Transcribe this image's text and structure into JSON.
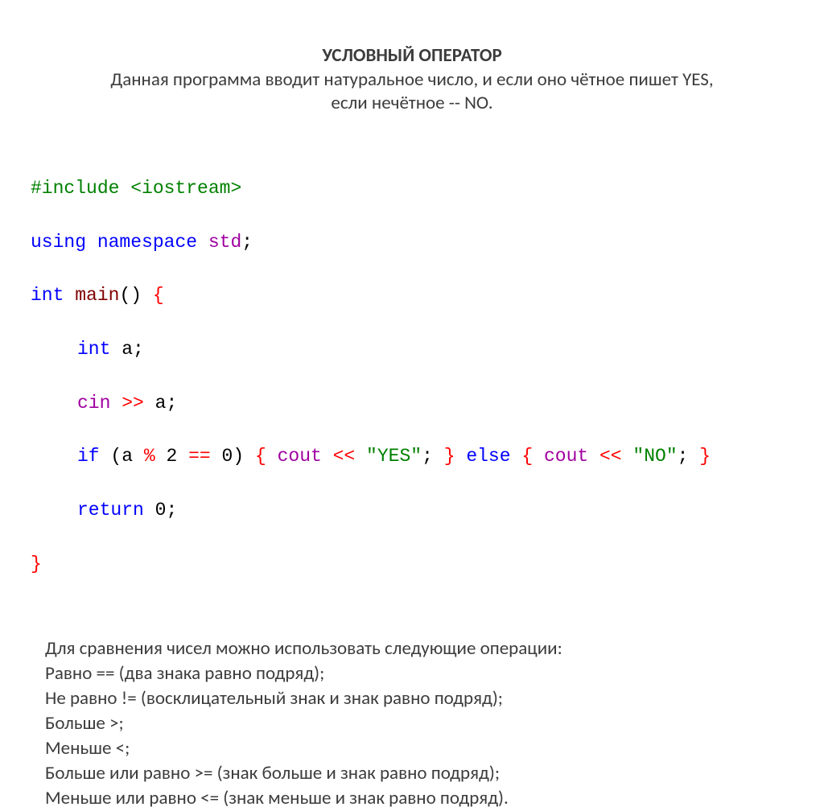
{
  "header": {
    "title": "УСЛОВНЫЙ ОПЕРАТОР",
    "desc_line1": "Данная программа вводит натуральное число, и если оно чётное пишет YES,",
    "desc_line2": "если нечётное -- NO."
  },
  "code": {
    "include_hash": "#include",
    "include_lib": " <iostream>",
    "using": "using",
    "namespace": "namespace",
    "std": "std",
    "semi": ";",
    "int_kw": "int",
    "main": "main",
    "parens": "()",
    "lbrace": "{",
    "rbrace": "}",
    "a_var": "a",
    "cin": "cin",
    "shr": ">>",
    "shl": "<<",
    "if_kw": "if",
    "lparen": "(",
    "rparen": ")",
    "mod": "%",
    "two": "2",
    "eqeq": "==",
    "zero": "0",
    "cout": "cout",
    "yes_str": "\"YES\"",
    "no_str": "\"NO\"",
    "else_kw": "else",
    "return_kw": "return"
  },
  "notes": {
    "l1": "Для сравнения чисел можно использовать следующие операции:",
    "l2": "Равно == (два знака равно подряд);",
    "l3": "Не равно != (восклицательный знак и знак равно подряд);",
    "l4": "Больше >;",
    "l5": "Меньше <;",
    "l6": "Больше или равно >= (знак больше и знак равно подряд);",
    "l7": "Меньше или равно <= (знак меньше и знак равно подряд)."
  }
}
